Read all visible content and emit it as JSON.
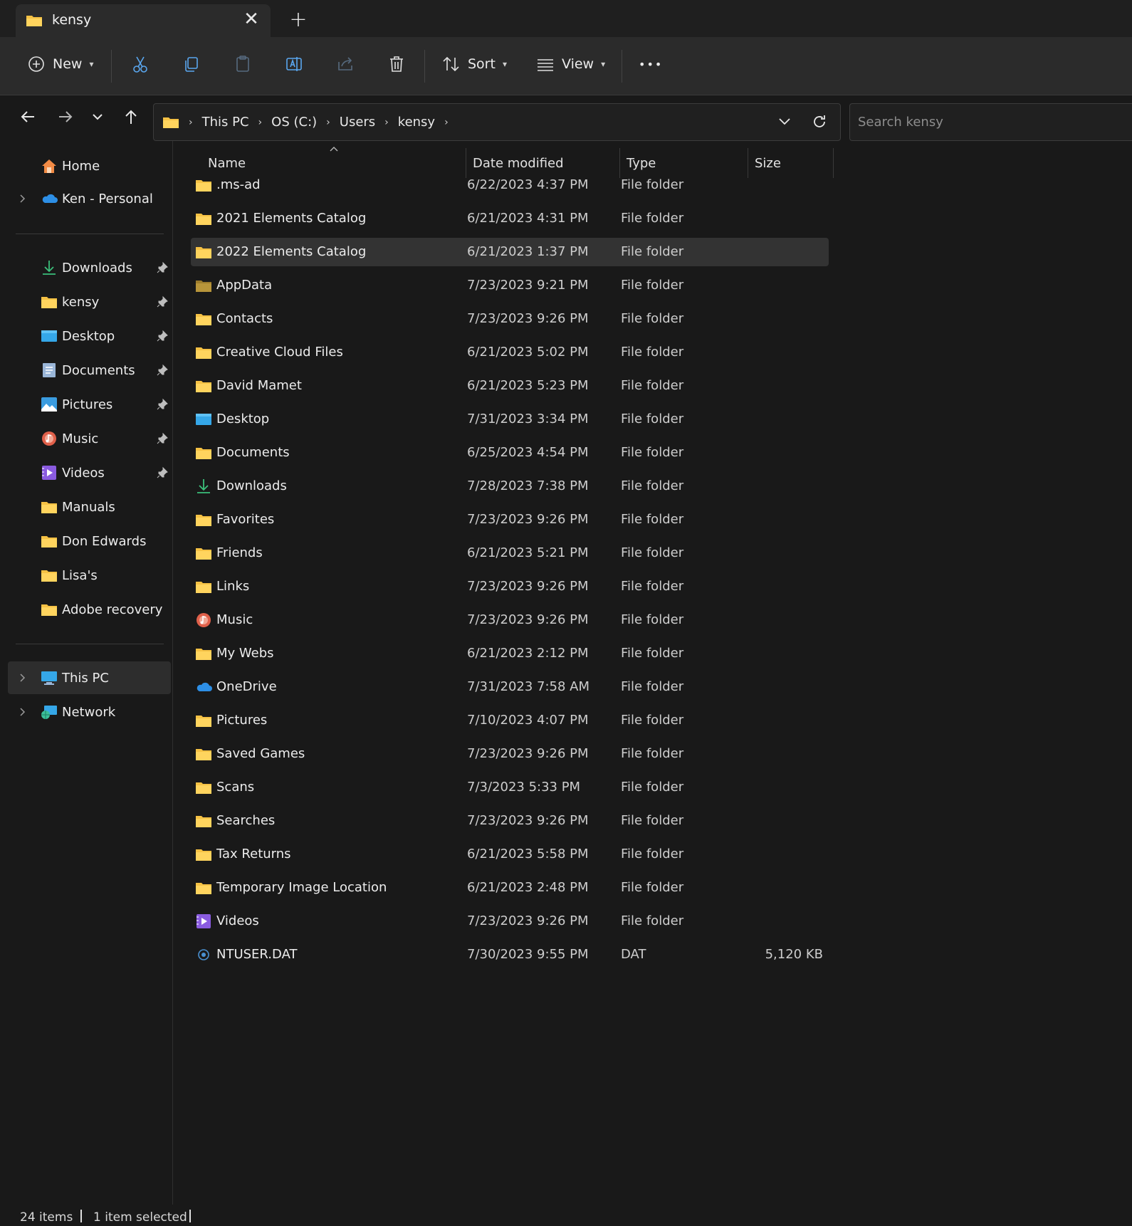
{
  "tab": {
    "title": "kensy",
    "close_glyph": "✕",
    "new_tab_glyph": "+"
  },
  "toolbar": {
    "new_label": "New",
    "sort_label": "Sort",
    "view_label": "View",
    "more_glyph": "•••",
    "icons": [
      "plus-circle-icon",
      "cut-icon",
      "copy-icon",
      "paste-icon",
      "rename-icon",
      "share-icon",
      "delete-icon",
      "sort-icon",
      "view-icon",
      "more-icon"
    ]
  },
  "address": {
    "crumbs": [
      "This PC",
      "OS (C:)",
      "Users",
      "kensy"
    ],
    "separator": "›",
    "search_placeholder": "Search kensy"
  },
  "sidebar": {
    "top": [
      {
        "label": "Home",
        "icon": "home-icon",
        "expandable": false
      },
      {
        "label": "Ken - Personal",
        "icon": "onedrive-icon",
        "expandable": true
      }
    ],
    "quick_access": [
      {
        "label": "Downloads",
        "icon": "download-icon",
        "pinned": true
      },
      {
        "label": "kensy",
        "icon": "folder-icon",
        "pinned": true
      },
      {
        "label": "Desktop",
        "icon": "desktop-icon",
        "pinned": true
      },
      {
        "label": "Documents",
        "icon": "documents-icon",
        "pinned": true
      },
      {
        "label": "Pictures",
        "icon": "pictures-icon",
        "pinned": true
      },
      {
        "label": "Music",
        "icon": "music-icon",
        "pinned": true
      },
      {
        "label": "Videos",
        "icon": "videos-icon",
        "pinned": true
      },
      {
        "label": "Manuals",
        "icon": "folder-icon",
        "pinned": false
      },
      {
        "label": "Don Edwards",
        "icon": "folder-icon",
        "pinned": false
      },
      {
        "label": "Lisa's",
        "icon": "folder-icon",
        "pinned": false
      },
      {
        "label": "Adobe recovery",
        "icon": "folder-icon",
        "pinned": false
      }
    ],
    "bottom": [
      {
        "label": "This PC",
        "icon": "this-pc-icon",
        "expandable": true,
        "selected": true
      },
      {
        "label": "Network",
        "icon": "network-icon",
        "expandable": true,
        "selected": false
      }
    ]
  },
  "columns": {
    "name": "Name",
    "date": "Date modified",
    "type": "Type",
    "size": "Size"
  },
  "files": [
    {
      "name": ".ms-ad",
      "date": "6/22/2023 4:37 PM",
      "type": "File folder",
      "size": "",
      "icon": "folder"
    },
    {
      "name": "2021 Elements Catalog",
      "date": "6/21/2023 4:31 PM",
      "type": "File folder",
      "size": "",
      "icon": "folder"
    },
    {
      "name": "2022 Elements Catalog",
      "date": "6/21/2023 1:37 PM",
      "type": "File folder",
      "size": "",
      "icon": "folder",
      "selected": true
    },
    {
      "name": "AppData",
      "date": "7/23/2023 9:21 PM",
      "type": "File folder",
      "size": "",
      "icon": "folder-hidden"
    },
    {
      "name": "Contacts",
      "date": "7/23/2023 9:26 PM",
      "type": "File folder",
      "size": "",
      "icon": "folder"
    },
    {
      "name": "Creative Cloud Files",
      "date": "6/21/2023 5:02 PM",
      "type": "File folder",
      "size": "",
      "icon": "folder"
    },
    {
      "name": "David Mamet",
      "date": "6/21/2023 5:23 PM",
      "type": "File folder",
      "size": "",
      "icon": "folder"
    },
    {
      "name": "Desktop",
      "date": "7/31/2023 3:34 PM",
      "type": "File folder",
      "size": "",
      "icon": "desktop"
    },
    {
      "name": "Documents",
      "date": "6/25/2023 4:54 PM",
      "type": "File folder",
      "size": "",
      "icon": "folder"
    },
    {
      "name": "Downloads",
      "date": "7/28/2023 7:38 PM",
      "type": "File folder",
      "size": "",
      "icon": "download"
    },
    {
      "name": "Favorites",
      "date": "7/23/2023 9:26 PM",
      "type": "File folder",
      "size": "",
      "icon": "folder"
    },
    {
      "name": "Friends",
      "date": "6/21/2023 5:21 PM",
      "type": "File folder",
      "size": "",
      "icon": "folder"
    },
    {
      "name": "Links",
      "date": "7/23/2023 9:26 PM",
      "type": "File folder",
      "size": "",
      "icon": "folder"
    },
    {
      "name": "Music",
      "date": "7/23/2023 9:26 PM",
      "type": "File folder",
      "size": "",
      "icon": "music"
    },
    {
      "name": "My Webs",
      "date": "6/21/2023 2:12 PM",
      "type": "File folder",
      "size": "",
      "icon": "folder"
    },
    {
      "name": "OneDrive",
      "date": "7/31/2023 7:58 AM",
      "type": "File folder",
      "size": "",
      "icon": "onedrive"
    },
    {
      "name": "Pictures",
      "date": "7/10/2023 4:07 PM",
      "type": "File folder",
      "size": "",
      "icon": "folder"
    },
    {
      "name": "Saved Games",
      "date": "7/23/2023 9:26 PM",
      "type": "File folder",
      "size": "",
      "icon": "folder"
    },
    {
      "name": "Scans",
      "date": "7/3/2023 5:33 PM",
      "type": "File folder",
      "size": "",
      "icon": "folder"
    },
    {
      "name": "Searches",
      "date": "7/23/2023 9:26 PM",
      "type": "File folder",
      "size": "",
      "icon": "folder"
    },
    {
      "name": "Tax Returns",
      "date": "6/21/2023 5:58 PM",
      "type": "File folder",
      "size": "",
      "icon": "folder"
    },
    {
      "name": "Temporary Image Location",
      "date": "6/21/2023 2:48 PM",
      "type": "File folder",
      "size": "",
      "icon": "folder"
    },
    {
      "name": "Videos",
      "date": "7/23/2023 9:26 PM",
      "type": "File folder",
      "size": "",
      "icon": "videos"
    },
    {
      "name": "NTUSER.DAT",
      "date": "7/30/2023 9:55 PM",
      "type": "DAT",
      "size": "5,120 KB",
      "icon": "dat-file"
    }
  ],
  "status": {
    "items": "24 items",
    "selected": "1 item selected"
  },
  "colors": {
    "background": "#191919",
    "toolbar": "#2b2b2b",
    "folder": "#f5c144",
    "selected_row": "#333333",
    "onedrive": "#2d8fe6"
  }
}
